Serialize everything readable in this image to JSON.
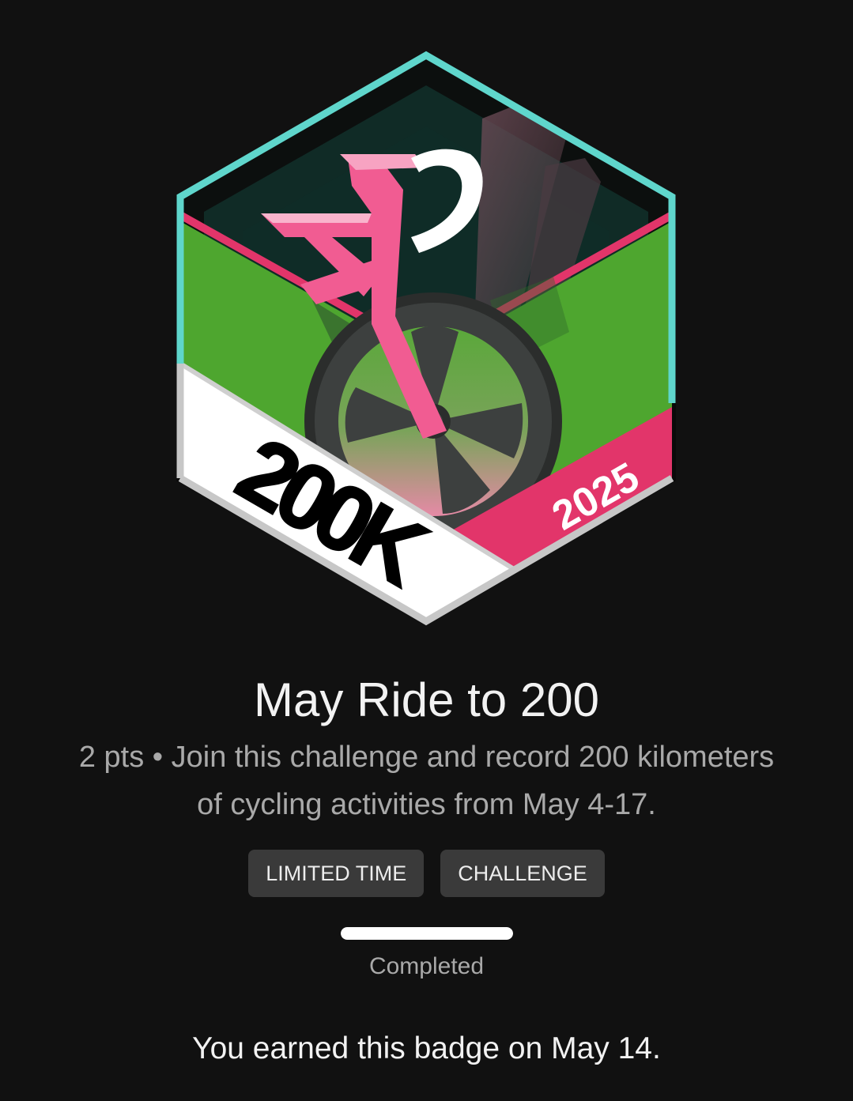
{
  "badge": {
    "distance_text": "200K",
    "year_text": "2025",
    "colors": {
      "teal_border": "#5fd6cc",
      "green": "#4ea62f",
      "dark_green": "#0f2a25",
      "pink": "#e2356a",
      "bike_pink": "#f15c92",
      "white_banner": "#ffffff",
      "grey_wheel": "#3f4240"
    },
    "icon": "bicycle-badge-icon"
  },
  "title": "May Ride to 200",
  "description": "2 pts • Join this challenge and record 200 kilometers of cycling activities from May 4-17.",
  "chips": [
    {
      "label": "LIMITED TIME"
    },
    {
      "label": "CHALLENGE"
    }
  ],
  "progress": {
    "fraction": 1.0
  },
  "status": "Completed",
  "earned": "You earned this badge on May 14."
}
